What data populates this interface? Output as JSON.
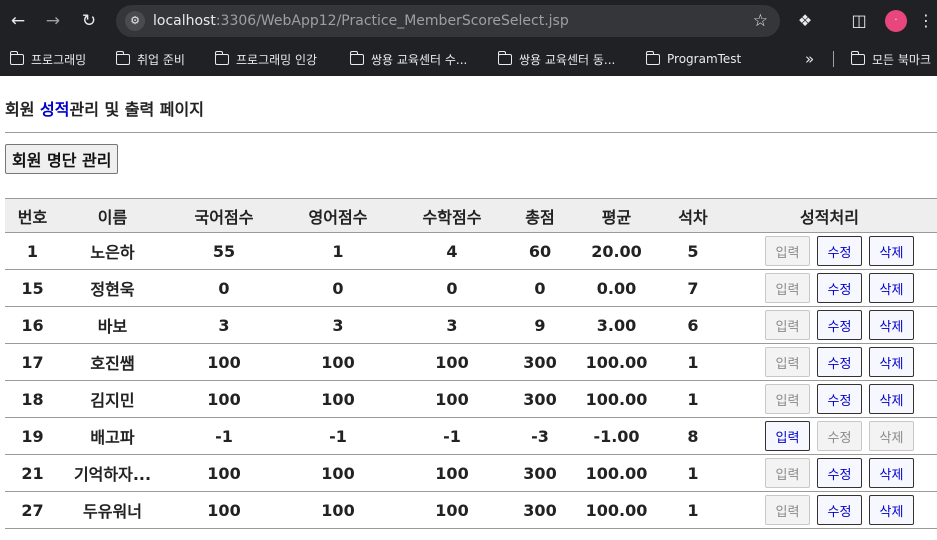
{
  "browser": {
    "url_host": "localhost",
    "url_path": ":3306/WebApp12/Practice_MemberScoreSelect.jsp",
    "bookmarks": [
      "프로그래밍",
      "취업 준비",
      "프로그래밍 인강",
      "쌍용 교육센터 수...",
      "쌍용 교육센터 동...",
      "ProgramTest"
    ],
    "other_bookmarks": "모든 북마크"
  },
  "page": {
    "title_prefix": "회원 ",
    "title_accent": "성적",
    "title_suffix": "관리 및 출력 페이지",
    "member_button": "회원 명단 관리"
  },
  "table": {
    "headers": [
      "번호",
      "이름",
      "국어점수",
      "영어점수",
      "수학점수",
      "총점",
      "평균",
      "석차",
      "성적처리"
    ],
    "action_labels": {
      "insert": "입력",
      "update": "수정",
      "delete": "삭제"
    },
    "rows": [
      {
        "no": "1",
        "name": "노은하",
        "kor": "55",
        "eng": "1",
        "mat": "4",
        "tot": "60",
        "avg": "20.00",
        "rank": "5",
        "insert_enabled": false,
        "update_enabled": true,
        "delete_enabled": true
      },
      {
        "no": "15",
        "name": "정현욱",
        "kor": "0",
        "eng": "0",
        "mat": "0",
        "tot": "0",
        "avg": "0.00",
        "rank": "7",
        "insert_enabled": false,
        "update_enabled": true,
        "delete_enabled": true
      },
      {
        "no": "16",
        "name": "바보",
        "kor": "3",
        "eng": "3",
        "mat": "3",
        "tot": "9",
        "avg": "3.00",
        "rank": "6",
        "insert_enabled": false,
        "update_enabled": true,
        "delete_enabled": true
      },
      {
        "no": "17",
        "name": "호진쌤",
        "kor": "100",
        "eng": "100",
        "mat": "100",
        "tot": "300",
        "avg": "100.00",
        "rank": "1",
        "insert_enabled": false,
        "update_enabled": true,
        "delete_enabled": true
      },
      {
        "no": "18",
        "name": "김지민",
        "kor": "100",
        "eng": "100",
        "mat": "100",
        "tot": "300",
        "avg": "100.00",
        "rank": "1",
        "insert_enabled": false,
        "update_enabled": true,
        "delete_enabled": true
      },
      {
        "no": "19",
        "name": "배고파",
        "kor": "-1",
        "eng": "-1",
        "mat": "-1",
        "tot": "-3",
        "avg": "-1.00",
        "rank": "8",
        "insert_enabled": true,
        "update_enabled": false,
        "delete_enabled": false
      },
      {
        "no": "21",
        "name": "기억하자...",
        "kor": "100",
        "eng": "100",
        "mat": "100",
        "tot": "300",
        "avg": "100.00",
        "rank": "1",
        "insert_enabled": false,
        "update_enabled": true,
        "delete_enabled": true
      },
      {
        "no": "27",
        "name": "두유워너",
        "kor": "100",
        "eng": "100",
        "mat": "100",
        "tot": "300",
        "avg": "100.00",
        "rank": "1",
        "insert_enabled": false,
        "update_enabled": true,
        "delete_enabled": true
      }
    ]
  }
}
